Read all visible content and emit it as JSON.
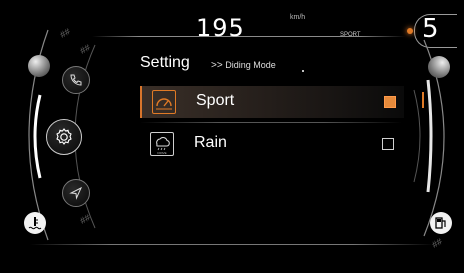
{
  "header": {
    "speed": "195",
    "speed_unit": "km/h",
    "drive_mode_small": "SPORT",
    "gear": "5"
  },
  "menu": {
    "title": "Setting",
    "breadcrumb_arrow": ">>",
    "breadcrumb": "Diding Mode"
  },
  "options": [
    {
      "label": "Sport",
      "icon": "sport-gauge-icon",
      "selected": true
    },
    {
      "label": "Rain",
      "icon": "rain-cloud-icon",
      "icon_caption": "DRIVE",
      "selected": false
    }
  ],
  "left_rail": {
    "icons": [
      "phone-icon",
      "settings-gear-icon",
      "navigation-arrow-icon",
      "coolant-temperature-icon"
    ]
  },
  "right_rail": {
    "icons": [
      "fuel-pump-icon"
    ]
  },
  "colors": {
    "accent": "#e07a26",
    "background": "#000000",
    "text": "#ffffff"
  }
}
